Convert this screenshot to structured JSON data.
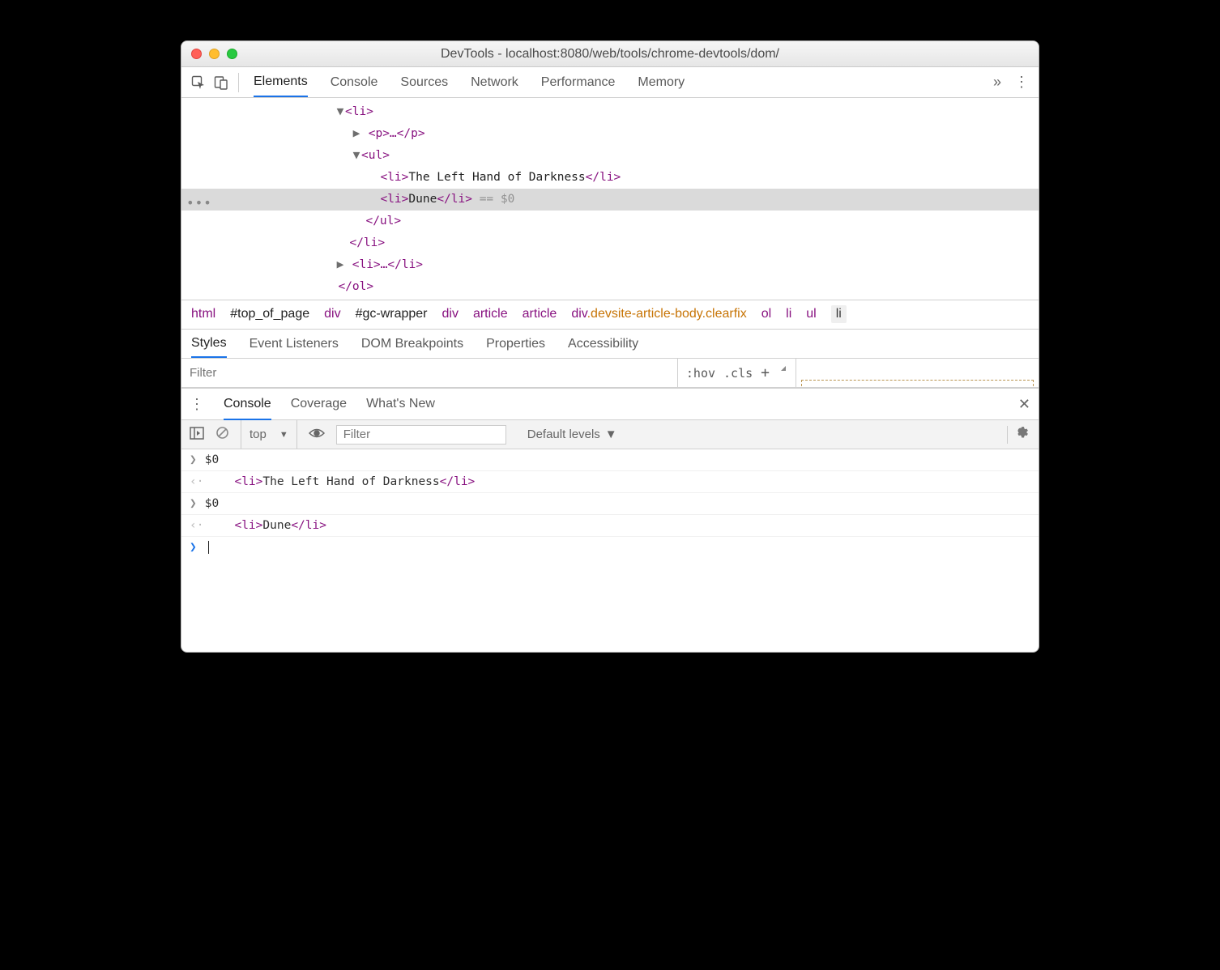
{
  "window": {
    "title": "DevTools - localhost:8080/web/tools/chrome-devtools/dom/"
  },
  "main_tabs": {
    "elements": "Elements",
    "console": "Console",
    "sources": "Sources",
    "network": "Network",
    "performance": "Performance",
    "memory": "Memory"
  },
  "tree": {
    "li_open": "<li>",
    "p_collapsed": "<p>…</p>",
    "ul_open": "<ul>",
    "li1_open": "<li>",
    "li1_text": "The Left Hand of Darkness",
    "li1_close": "</li>",
    "li2_open": "<li>",
    "li2_text": "Dune",
    "li2_close": "</li>",
    "li2_ref": " == $0",
    "ul_close": "</ul>",
    "li_close": "</li>",
    "li3": "<li>…</li>",
    "ol_close": "</ol>"
  },
  "crumbs": {
    "html": "html",
    "top": "#top_of_page",
    "div1": "div",
    "gc": "#gc-wrapper",
    "div2": "div",
    "art1": "article",
    "art2": "article",
    "divcls_tag": "div",
    "divcls_cls": ".devsite-article-body.clearfix",
    "ol": "ol",
    "li": "li",
    "ul": "ul",
    "last": "li"
  },
  "sub_tabs": {
    "styles": "Styles",
    "ev": "Event Listeners",
    "dom": "DOM Breakpoints",
    "props": "Properties",
    "acc": "Accessibility"
  },
  "filter": {
    "placeholder": "Filter",
    "hov": ":hov",
    "cls": ".cls",
    "plus": "+"
  },
  "drawer_tabs": {
    "console": "Console",
    "coverage": "Coverage",
    "whatsnew": "What's New"
  },
  "console_tb": {
    "context": "top",
    "filter_placeholder": "Filter",
    "levels": "Default levels"
  },
  "console": {
    "in1": "$0",
    "out1_open": "<li>",
    "out1_text": "The Left Hand of Darkness",
    "out1_close": "</li>",
    "in2": "$0",
    "out2_open": "<li>",
    "out2_text": "Dune",
    "out2_close": "</li>"
  }
}
